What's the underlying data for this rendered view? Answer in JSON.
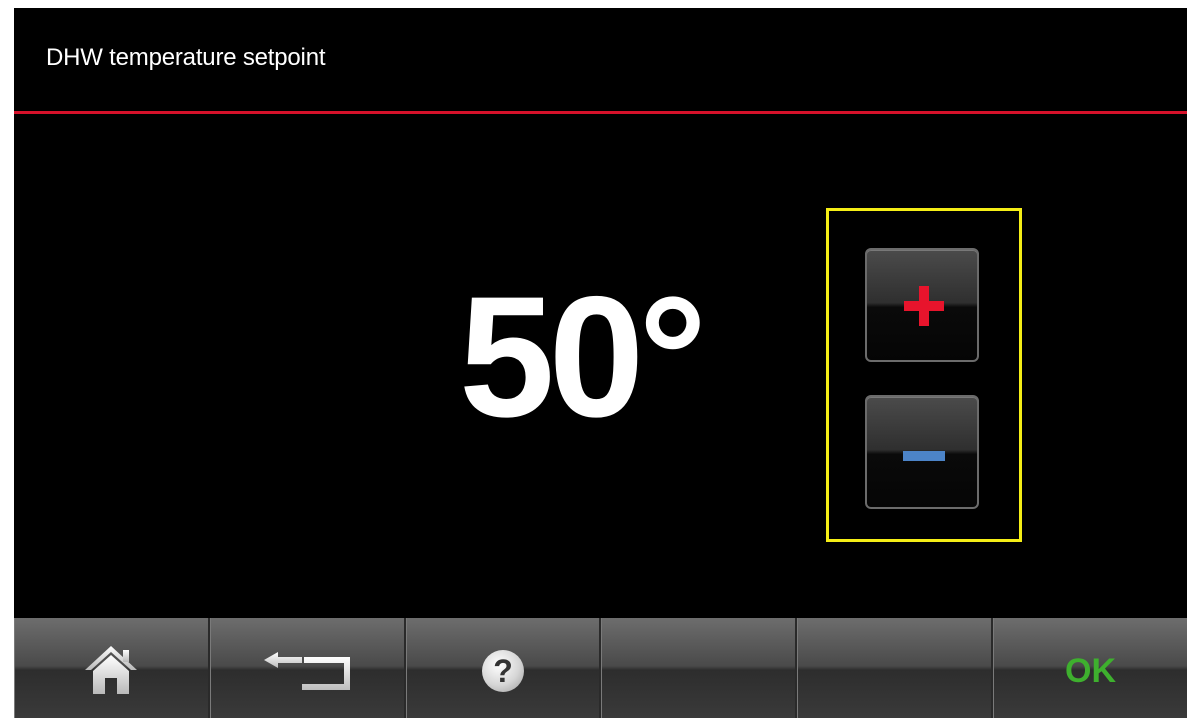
{
  "header": {
    "title": "DHW temperature setpoint"
  },
  "setpoint": {
    "value": "50°"
  },
  "stepper": {
    "increase_icon": "plus-icon",
    "decrease_icon": "minus-icon"
  },
  "toolbar": {
    "buttons": [
      {
        "name": "home",
        "icon": "home-icon"
      },
      {
        "name": "back",
        "icon": "back-arrow-icon"
      },
      {
        "name": "help",
        "icon": "help-icon",
        "label": "?"
      },
      {
        "name": "empty-1"
      },
      {
        "name": "empty-2"
      },
      {
        "name": "ok",
        "label": "OK"
      }
    ]
  },
  "colors": {
    "accent_line": "#d6112a",
    "plus": "#e8142c",
    "minus": "#4c84c8",
    "highlight": "#f5ee16",
    "ok": "#3eb02e"
  }
}
